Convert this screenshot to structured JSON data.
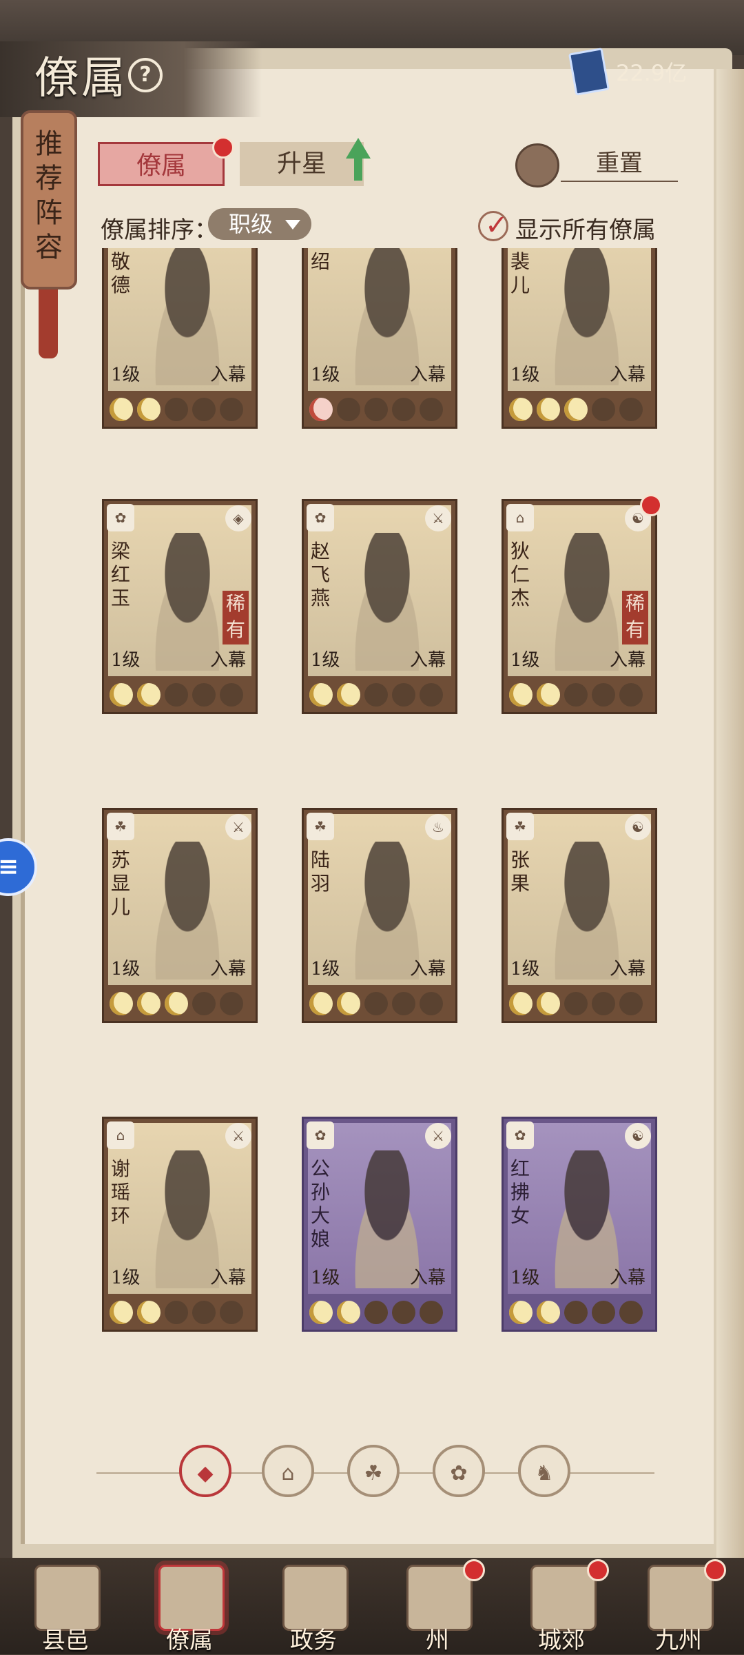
{
  "header": {
    "title": "僚属",
    "help_icon": "?",
    "currency_value": "22.9亿",
    "currency_icon": "book-icon"
  },
  "side_tab": {
    "label": "推荐阵容"
  },
  "tabs": {
    "tab1": "僚属",
    "tab2": "升星",
    "reset": "重置"
  },
  "sort": {
    "label": "僚属排序：",
    "value": "职级",
    "show_all": "显示所有僚属"
  },
  "cards": [
    {
      "name": "迟敬德",
      "level": "1级",
      "status": "入幕",
      "stars": 2
    },
    {
      "name": "柴绍",
      "level": "1级",
      "status": "入幕",
      "stars": 1,
      "star_color": "red"
    },
    {
      "name": "孛裴儿",
      "level": "1级",
      "status": "入幕",
      "stars": 3
    },
    {
      "name": "梁红玉",
      "level": "1级",
      "status": "入幕",
      "stars": 2,
      "rare": "稀有"
    },
    {
      "name": "赵飞燕",
      "level": "1级",
      "status": "入幕",
      "stars": 2
    },
    {
      "name": "狄仁杰",
      "level": "1级",
      "status": "入幕",
      "stars": 2,
      "rare": "稀有",
      "reddot": true
    },
    {
      "name": "苏显儿",
      "level": "1级",
      "status": "入幕",
      "stars": 3
    },
    {
      "name": "陆羽",
      "level": "1级",
      "status": "入幕",
      "stars": 2
    },
    {
      "name": "张果",
      "level": "1级",
      "status": "入幕",
      "stars": 2
    },
    {
      "name": "谢瑶环",
      "level": "1级",
      "status": "入幕",
      "stars": 2
    },
    {
      "name": "公孙大娘",
      "level": "1级",
      "status": "入幕",
      "stars": 2,
      "purple": true
    },
    {
      "name": "红拂女",
      "level": "1级",
      "status": "入幕",
      "stars": 2,
      "purple": true
    }
  ],
  "filters": [
    "diamond-icon",
    "hat-icon",
    "cat-icon",
    "fan-icon",
    "lion-icon"
  ],
  "bottom_nav": [
    {
      "label": "县邑",
      "reddot": false
    },
    {
      "label": "僚属",
      "reddot": false,
      "active": true
    },
    {
      "label": "政务",
      "reddot": false
    },
    {
      "label": "州",
      "reddot": true
    },
    {
      "label": "城郊",
      "reddot": true
    },
    {
      "label": "九州",
      "reddot": true
    }
  ]
}
